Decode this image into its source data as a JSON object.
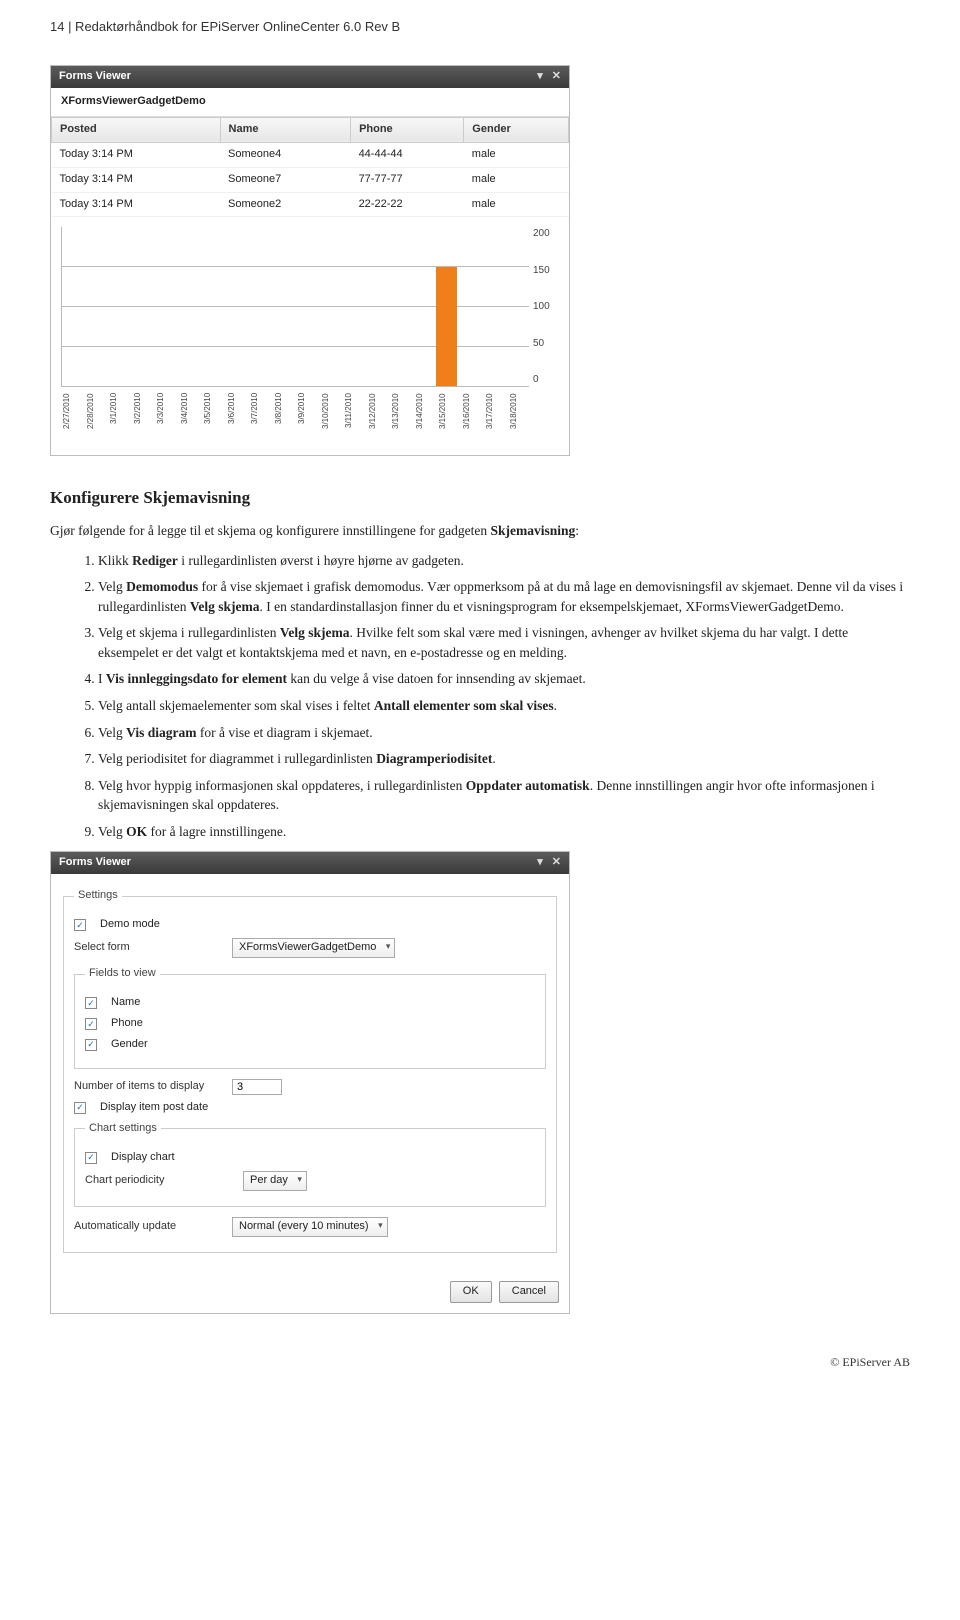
{
  "header": "14 | Redaktørhåndbok for EPiServer OnlineCenter 6.0 Rev B",
  "viewer1": {
    "title": "Forms Viewer",
    "subtitle": "XFormsViewerGadgetDemo",
    "columns": [
      "Posted",
      "Name",
      "Phone",
      "Gender"
    ],
    "rows": [
      [
        "Today 3:14 PM",
        "Someone4",
        "44-44-44",
        "male"
      ],
      [
        "Today 3:14 PM",
        "Someone7",
        "77-77-77",
        "male"
      ],
      [
        "Today 3:14 PM",
        "Someone2",
        "22-22-22",
        "male"
      ]
    ]
  },
  "chart_data": {
    "type": "bar",
    "categories": [
      "2/27/2010",
      "2/28/2010",
      "3/1/2010",
      "3/2/2010",
      "3/3/2010",
      "3/4/2010",
      "3/5/2010",
      "3/6/2010",
      "3/7/2010",
      "3/8/2010",
      "3/9/2010",
      "3/10/2010",
      "3/11/2010",
      "3/12/2010",
      "3/13/2010",
      "3/14/2010",
      "3/15/2010",
      "3/16/2010",
      "3/17/2010",
      "3/18/2010"
    ],
    "values": [
      0,
      0,
      0,
      0,
      0,
      0,
      0,
      0,
      0,
      0,
      0,
      0,
      0,
      0,
      0,
      0,
      150,
      0,
      0,
      0
    ],
    "ylim": [
      0,
      200
    ],
    "yticks": [
      0,
      50,
      100,
      150,
      200
    ],
    "title": "",
    "xlabel": "",
    "ylabel": ""
  },
  "section_title": "Konfigurere Skjemavisning",
  "intro_pre": "Gjør følgende for å legge til et skjema og konfigurere innstillingene for gadgeten ",
  "intro_bold": "Skjemavisning",
  "intro_post": ":",
  "steps": [
    {
      "parts": [
        "Klikk ",
        {
          "b": "Rediger"
        },
        " i rullegardinlisten øverst i høyre hjørne av gadgeten."
      ]
    },
    {
      "parts": [
        "Velg ",
        {
          "b": "Demomodus"
        },
        " for å vise skjemaet i grafisk demomodus. Vær oppmerksom på at du må lage en demovisningsfil av skjemaet. Denne vil da vises i rullegardinlisten ",
        {
          "b": "Velg skjema"
        },
        ". I en standardinstallasjon finner du et visningsprogram for eksempelskjemaet, XFormsViewerGadgetDemo."
      ]
    },
    {
      "parts": [
        "Velg et skjema i rullegardinlisten ",
        {
          "b": "Velg skjema"
        },
        ". Hvilke felt som skal være med i visningen, avhenger av hvilket skjema du har valgt. I dette eksempelet er det valgt et kontaktskjema med et navn, en e-postadresse og en melding."
      ]
    },
    {
      "parts": [
        "I ",
        {
          "b": "Vis innleggingsdato for element"
        },
        " kan du velge å vise datoen for innsending av skjemaet."
      ]
    },
    {
      "parts": [
        "Velg antall skjemaelementer som skal vises i feltet ",
        {
          "b": "Antall elementer som skal vises"
        },
        "."
      ]
    },
    {
      "parts": [
        "Velg ",
        {
          "b": "Vis diagram"
        },
        " for å vise et diagram i skjemaet."
      ]
    },
    {
      "parts": [
        "Velg periodisitet for diagrammet i rullegardinlisten ",
        {
          "b": "Diagramperiodisitet"
        },
        "."
      ]
    },
    {
      "parts": [
        "Velg hvor hyppig informasjonen skal oppdateres, i rullegardinlisten ",
        {
          "b": "Oppdater automatisk"
        },
        ". Denne innstillingen angir hvor ofte informasjonen i skjemavisningen skal oppdateres."
      ]
    },
    {
      "parts": [
        "Velg ",
        {
          "b": "OK"
        },
        " for å lagre innstillingene."
      ]
    }
  ],
  "viewer2": {
    "title": "Forms Viewer",
    "legend_settings": "Settings",
    "demo_mode": "Demo mode",
    "select_form_label": "Select form",
    "select_form_value": "XFormsViewerGadgetDemo",
    "legend_fields": "Fields to view",
    "fields": [
      "Name",
      "Phone",
      "Gender"
    ],
    "num_items_label": "Number of items to display",
    "num_items_value": "3",
    "display_post_date": "Display item post date",
    "legend_chart": "Chart settings",
    "display_chart": "Display chart",
    "chart_periodicity_label": "Chart periodicity",
    "chart_periodicity_value": "Per day",
    "auto_update_label": "Automatically update",
    "auto_update_value": "Normal (every 10 minutes)",
    "ok": "OK",
    "cancel": "Cancel"
  },
  "footer": "© EPiServer AB"
}
